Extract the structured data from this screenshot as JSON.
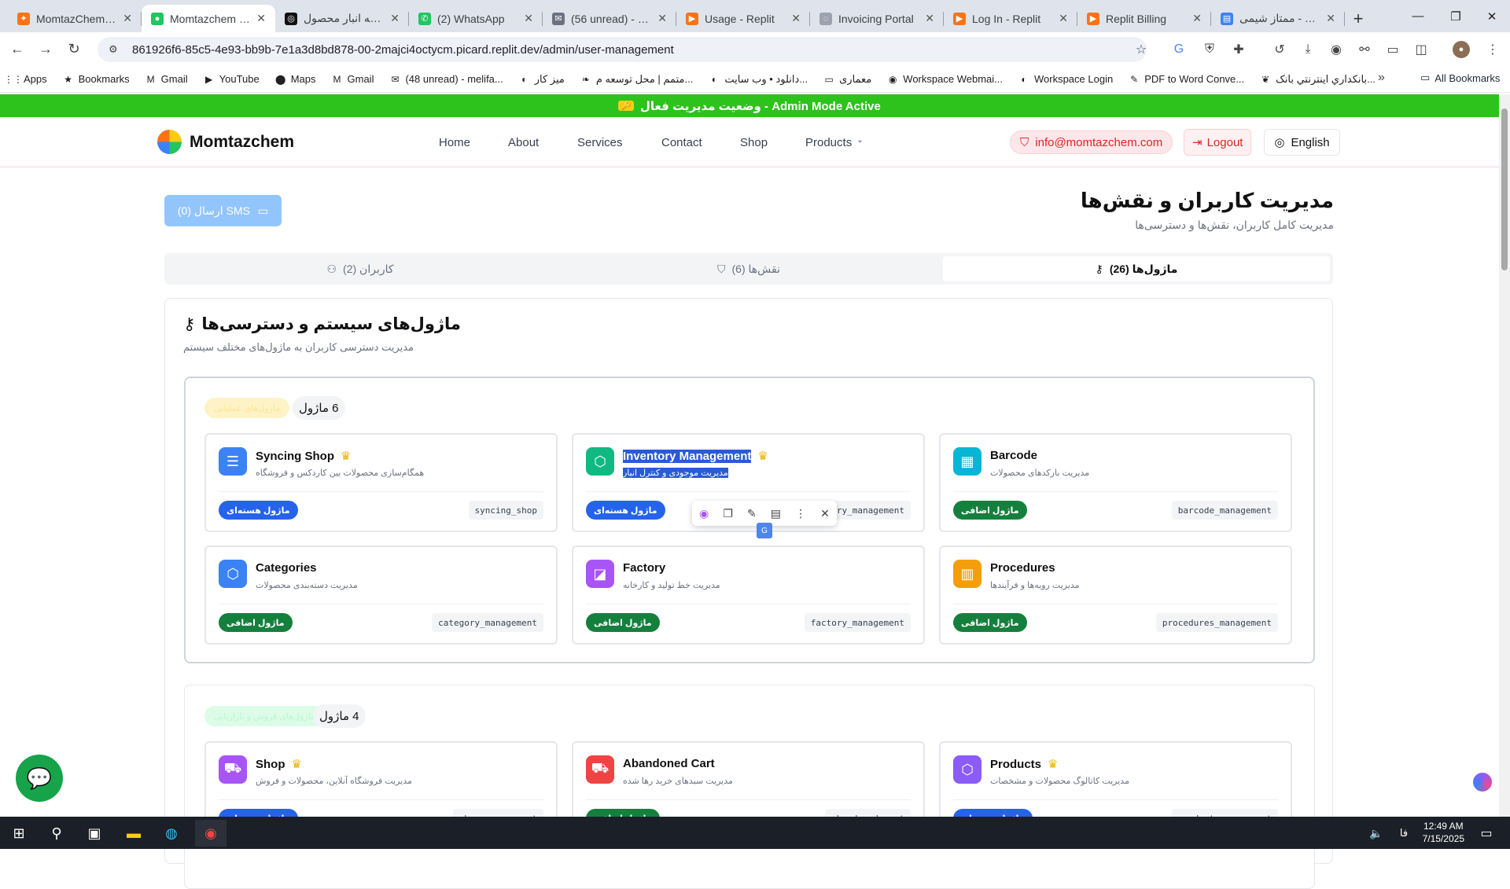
{
  "browser": {
    "tabs": [
      {
        "title": "MomtazChemWe",
        "color": "#f97316",
        "glyph": "✦",
        "active": false
      },
      {
        "title": "Momtazchem - Le",
        "color": "#22c55e",
        "glyph": "●",
        "active": true
      },
      {
        "title": "ترجمه انبار محصول",
        "color": "#111111",
        "glyph": "◎",
        "active": false
      },
      {
        "title": "(2) WhatsApp",
        "color": "#22c55e",
        "glyph": "✆",
        "active": false
      },
      {
        "title": "(56 unread) - Inbo",
        "color": "#6b7280",
        "glyph": "✉",
        "active": false
      },
      {
        "title": "Usage - Replit",
        "color": "#f97316",
        "glyph": "▶",
        "active": false
      },
      {
        "title": "Invoicing Portal",
        "color": "#9ca3af",
        "glyph": "◌",
        "active": false
      },
      {
        "title": "Log In - Replit",
        "color": "#f97316",
        "glyph": "▶",
        "active": false
      },
      {
        "title": "Replit Billing",
        "color": "#f97316",
        "glyph": "▶",
        "active": false
      },
      {
        "title": "ممتاز شیمی - Docs",
        "color": "#3b82f6",
        "glyph": "▤",
        "active": false
      }
    ],
    "url": "861926f6-85c5-4e93-bb9b-7e1a3d8bd878-00-2majci4octycm.picard.replit.dev/admin/user-management",
    "bookmarks": [
      {
        "label": "Apps",
        "icon": "apps-icon",
        "glyph": "⋮⋮"
      },
      {
        "label": "Bookmarks",
        "icon": "star-icon",
        "glyph": "★"
      },
      {
        "label": "Gmail",
        "icon": "gmail-icon",
        "glyph": "M"
      },
      {
        "label": "YouTube",
        "icon": "youtube-icon",
        "glyph": "▶"
      },
      {
        "label": "Maps",
        "icon": "maps-icon",
        "glyph": "⬤"
      },
      {
        "label": "Gmail",
        "icon": "gmail-icon",
        "glyph": "M"
      },
      {
        "label": "(48 unread) - melifa...",
        "icon": "yahoo-mail-icon",
        "glyph": "✉"
      },
      {
        "label": "میز کار",
        "icon": "globe-icon",
        "glyph": "◐"
      },
      {
        "label": "متمم | محل توسعه م...",
        "icon": "leaf-icon",
        "glyph": "❧"
      },
      {
        "label": "دانلود • وب سایت...",
        "icon": "globe-icon",
        "glyph": "◐"
      },
      {
        "label": "معماری",
        "icon": "folder-icon",
        "glyph": "▭"
      },
      {
        "label": "Workspace Webmai...",
        "icon": "globe-icon",
        "glyph": "◉"
      },
      {
        "label": "Workspace Login",
        "icon": "globe-icon",
        "glyph": "◐"
      },
      {
        "label": "PDF to Word Conve...",
        "icon": "pdf-icon",
        "glyph": "✎"
      },
      {
        "label": "بانکداري اینترنتي بانک...",
        "icon": "bank-icon",
        "glyph": "❦"
      }
    ],
    "all_bookmarks": "All Bookmarks"
  },
  "admin_banner": "وضعیت مدیریت فعال - Admin Mode Active",
  "site": {
    "brand": "Momtazchem",
    "nav": [
      "Home",
      "About",
      "Services",
      "Contact",
      "Shop",
      "Products"
    ],
    "email": "info@momtazchem.com",
    "logout": "Logout",
    "language": "English"
  },
  "page": {
    "sms_button": "ارسال (0) SMS",
    "title": "مدیریت کاربران و نقش‌ها",
    "subtitle": "مدیریت کامل کاربران، نقش‌ها و دسترسی‌ها",
    "tabs": [
      {
        "label": "کاربران (2)",
        "icon": "users-icon",
        "active": false
      },
      {
        "label": "نقش‌ها (6)",
        "icon": "shield-icon",
        "active": false
      },
      {
        "label": "ماژول‌ها (26)",
        "icon": "key-icon",
        "active": true
      }
    ],
    "panel_title": "ماژول‌های سیستم و دسترسی‌ها",
    "panel_subtitle": "مدیریت دسترسی کاربران به ماژول‌های مختلف سیستم",
    "groups": [
      {
        "count": "6 ماژول",
        "badge": "ماژول‌های عملیاتی",
        "badge_color": "#fef3c7",
        "modules": [
          {
            "title": "Syncing Shop",
            "desc": "همگام‌سازی محصولات بین کاردکس و فروشگاه",
            "badge": "ماژول هسته‌ای",
            "badge_color": "#2563eb",
            "code": "syncing_shop",
            "icon": "database-icon",
            "icon_color": "#3b82f6",
            "core": true
          },
          {
            "title": "Inventory Management",
            "desc": "مدیریت موجودی و کنترل انبار",
            "badge": "ماژول هسته‌ای",
            "badge_color": "#2563eb",
            "code": "inventory_management",
            "icon": "box-icon",
            "icon_color": "#10b981",
            "core": true
          },
          {
            "title": "Barcode",
            "desc": "مدیریت بارکدهای محصولات",
            "badge": "ماژول اضافی",
            "badge_color": "#15803d",
            "code": "barcode_management",
            "icon": "qr-icon",
            "icon_color": "#06b6d4",
            "core": false
          },
          {
            "title": "Categories",
            "desc": "مدیریت دسته‌بندی محصولات",
            "badge": "ماژول اضافی",
            "badge_color": "#15803d",
            "code": "category_management",
            "icon": "cube-icon",
            "icon_color": "#3b82f6",
            "core": false
          },
          {
            "title": "Factory",
            "desc": "مدیریت خط تولید و کارخانه",
            "badge": "ماژول اضافی",
            "badge_color": "#15803d",
            "code": "factory_management",
            "icon": "chart-icon",
            "icon_color": "#a855f7",
            "core": false
          },
          {
            "title": "Procedures",
            "desc": "مدیریت رویه‌ها و فرآیندها",
            "badge": "ماژول اضافی",
            "badge_color": "#15803d",
            "code": "procedures_management",
            "icon": "book-icon",
            "icon_color": "#f59e0b",
            "core": false
          }
        ]
      },
      {
        "count": "4 ماژول",
        "badge": "ماژول‌های فروش و بازاریابی",
        "badge_color": "#dcfce7",
        "modules": [
          {
            "title": "Shop",
            "desc": "مدیریت فروشگاه آنلاین، محصولات و فروش",
            "badge": "ماژول هسته‌ای",
            "badge_color": "#2563eb",
            "code": "shop_management",
            "icon": "cart-icon",
            "icon_color": "#a855f7",
            "core": true
          },
          {
            "title": "Abandoned Cart",
            "desc": "مدیریت سبدهای خرید رها شده",
            "badge": "ماژول اضافی",
            "badge_color": "#15803d",
            "code": "abandoned_cart",
            "icon": "cart-icon",
            "icon_color": "#ef4444",
            "core": false
          },
          {
            "title": "Products",
            "desc": "مدیریت کاتالوگ محصولات و مشخصات",
            "badge": "ماژول هسته‌ای",
            "badge_color": "#2563eb",
            "code": "product_management",
            "icon": "cube-icon",
            "icon_color": "#8b5cf6",
            "core": true
          }
        ]
      }
    ]
  },
  "taskbar": {
    "time": "12:49 AM",
    "date": "7/15/2025",
    "lang": "فا"
  }
}
